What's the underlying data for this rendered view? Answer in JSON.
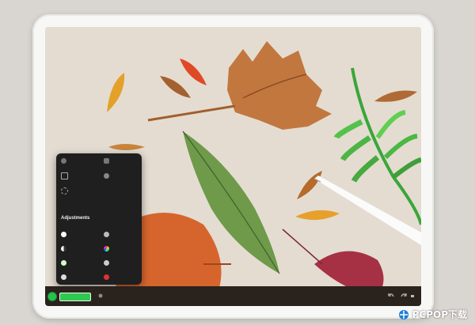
{
  "menu": {
    "section_title": "Adjustments",
    "top_items": [
      "",
      "",
      "",
      "",
      ""
    ],
    "adjust_items": [
      "",
      "",
      "",
      "",
      "",
      "",
      "",
      ""
    ]
  },
  "toolbar": {
    "active_color": "#27c24a"
  },
  "watermark": {
    "brand": "PCPOP下载",
    "sub": "PCPOP Download"
  }
}
